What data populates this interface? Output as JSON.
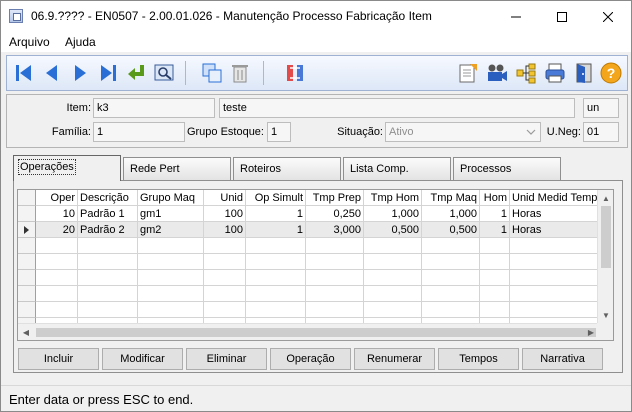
{
  "window": {
    "title": "06.9.???? - EN0507 - 2.00.01.026 - Manutenção Processo Fabricação Item"
  },
  "menu": [
    "Arquivo",
    "Ajuda"
  ],
  "toolbar_icons": [
    "first-icon",
    "prev-icon",
    "next-icon",
    "last-icon",
    "go-to-icon",
    "search-icon",
    "copy-icon",
    "delete-icon",
    "swap-icon",
    "report-icon",
    "camera-icon",
    "tree-icon",
    "print-icon",
    "exit-icon",
    "help-icon"
  ],
  "form": {
    "item_label": "Item:",
    "item_code": "k3",
    "item_desc": "teste",
    "unit": "un",
    "familia_label": "Família:",
    "familia": "1",
    "grupo_estoque_label": "Grupo Estoque:",
    "grupo_estoque": "1",
    "situacao_label": "Situação:",
    "situacao": "Ativo",
    "uneg_label": "U.Neg:",
    "uneg": "01"
  },
  "tabs": [
    "Operações",
    "Rede Pert",
    "Roteiros",
    "Lista Comp.",
    "Processos"
  ],
  "grid": {
    "columns": [
      "Oper",
      "Descrição",
      "Grupo Maq",
      "Unid",
      "Op Simult",
      "Tmp Prep",
      "Tmp Hom",
      "Tmp Maq",
      "Hom",
      "Unid Medid Tempo"
    ],
    "rows": [
      [
        "10",
        "Padrão 1",
        "gm1",
        "100",
        "1",
        "0,250",
        "1,000",
        "1,000",
        "1",
        "Horas"
      ],
      [
        "20",
        "Padrão 2",
        "gm2",
        "100",
        "1",
        "3,000",
        "0,500",
        "0,500",
        "1",
        "Horas"
      ]
    ]
  },
  "buttons": [
    "Incluir",
    "Modificar",
    "Eliminar",
    "Operação",
    "Renumerar",
    "Tempos",
    "Narrativa"
  ],
  "status": "Enter data or press ESC to end.",
  "colors": {
    "toolbar_blue": "#2a6fd6",
    "selected_row": "#eaeaea"
  }
}
